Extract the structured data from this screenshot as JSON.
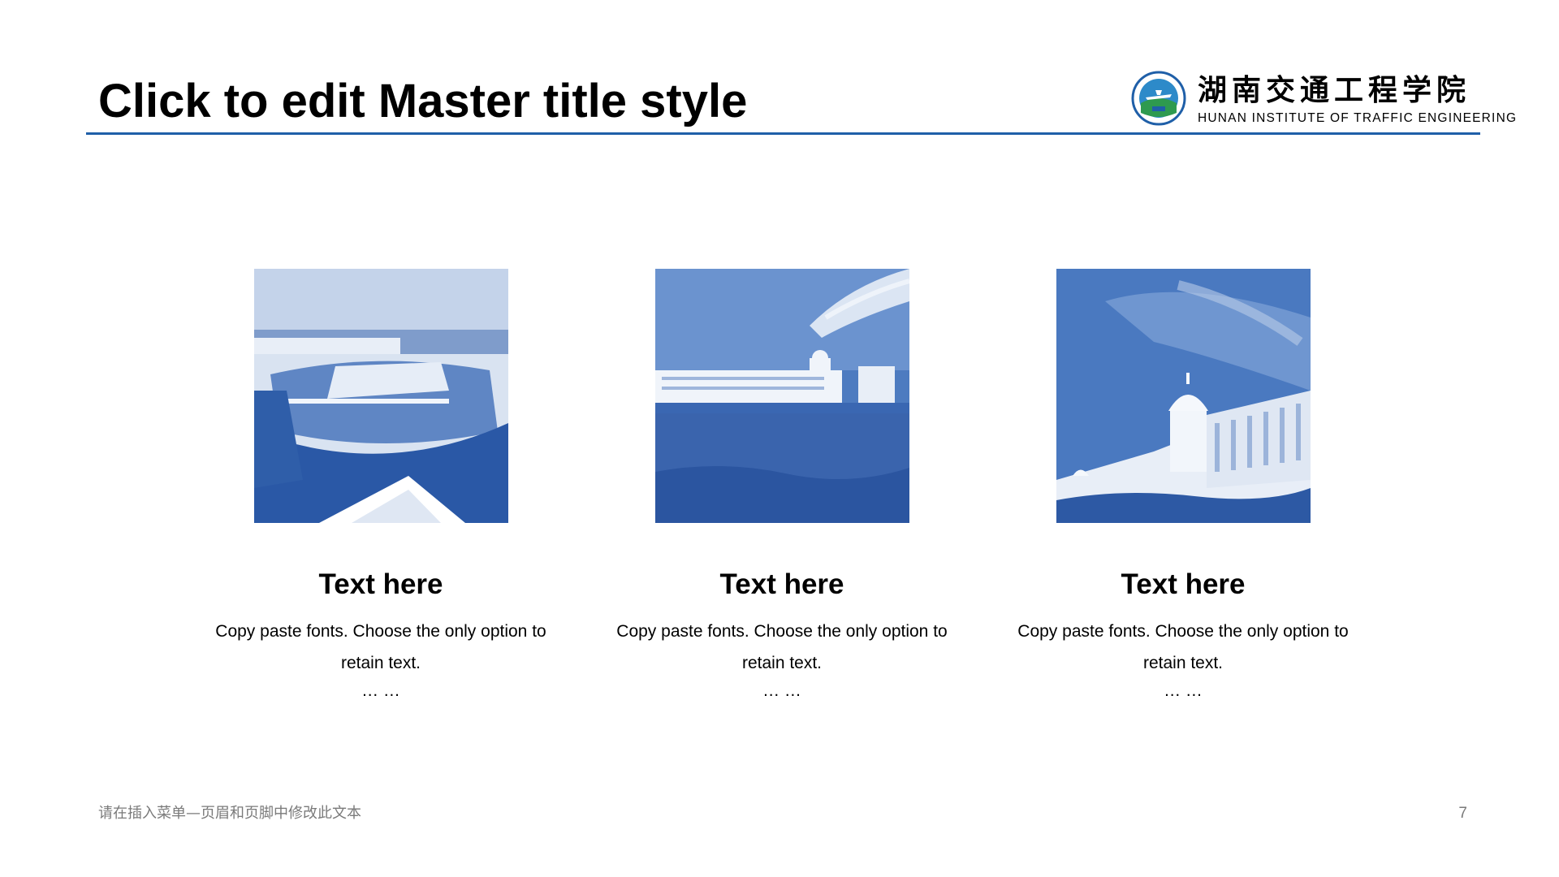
{
  "slide": {
    "title": "Click to edit Master title style",
    "accent_color": "#1f5fa8",
    "photo_tint": "#2d5da8"
  },
  "logo": {
    "name_cn": "湖南交通工程学院",
    "name_en": "HUNAN INSTITUTE OF TRAFFIC ENGINEERING",
    "icon": "school-emblem-icon"
  },
  "cards": [
    {
      "image": "campus-lake-photo",
      "heading": "Text here",
      "body": "Copy paste fonts. Choose the only option to retain text.",
      "ellipsis": "… …"
    },
    {
      "image": "campus-lawn-photo",
      "heading": "Text here",
      "body": "Copy paste fonts. Choose the only option to retain text.",
      "ellipsis": "… …"
    },
    {
      "image": "domed-building-photo",
      "heading": "Text here",
      "body": "Copy paste fonts. Choose the only option to retain text.",
      "ellipsis": "… …"
    }
  ],
  "footer": {
    "text": "请在插入菜单—页眉和页脚中修改此文本",
    "page_number": "7"
  }
}
